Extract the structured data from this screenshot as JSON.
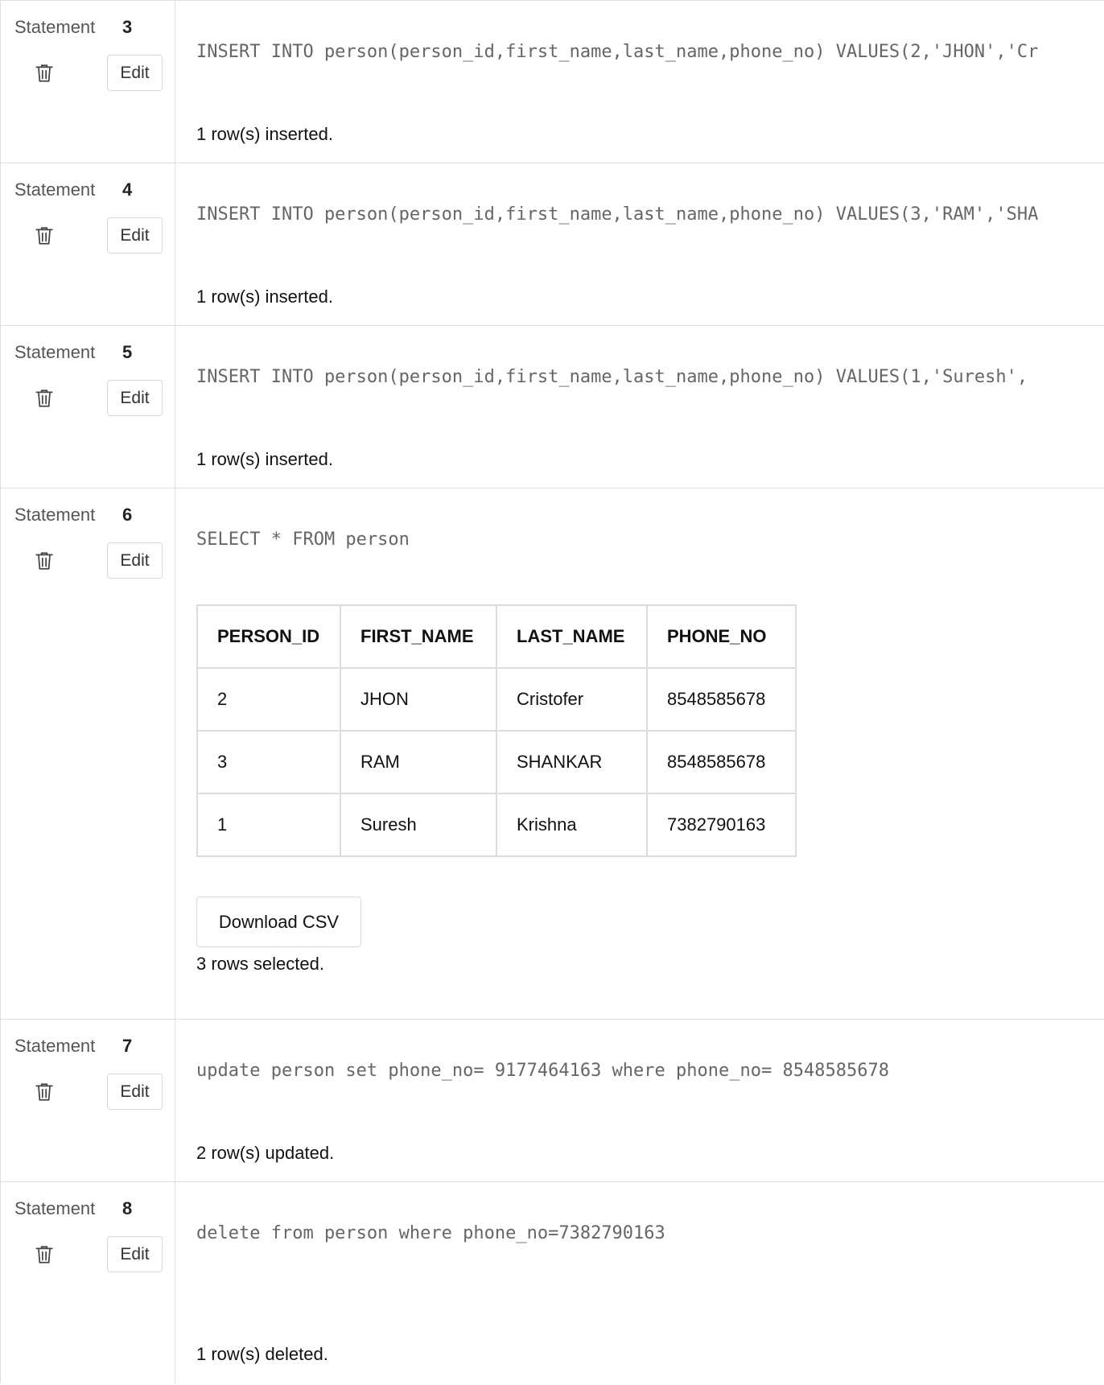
{
  "statements": [
    {
      "label": "Statement",
      "number": "3",
      "edit_label": "Edit",
      "sql": "INSERT INTO person(person_id,first_name,last_name,phone_no) VALUES(2,'JHON','Cr",
      "result": "1 row(s) inserted."
    },
    {
      "label": "Statement",
      "number": "4",
      "edit_label": "Edit",
      "sql": "INSERT INTO person(person_id,first_name,last_name,phone_no) VALUES(3,'RAM','SHA",
      "result": "1 row(s) inserted."
    },
    {
      "label": "Statement",
      "number": "5",
      "edit_label": "Edit",
      "sql": "INSERT INTO person(person_id,first_name,last_name,phone_no) VALUES(1,'Suresh',",
      "result": "1 row(s) inserted."
    },
    {
      "label": "Statement",
      "number": "6",
      "edit_label": "Edit",
      "sql": "SELECT * FROM person",
      "table": {
        "columns": [
          "PERSON_ID",
          "FIRST_NAME",
          "LAST_NAME",
          "PHONE_NO"
        ],
        "rows": [
          [
            "2",
            "JHON",
            "Cristofer",
            "8548585678"
          ],
          [
            "3",
            "RAM",
            "SHANKAR",
            "8548585678"
          ],
          [
            "1",
            "Suresh",
            "Krishna",
            "7382790163"
          ]
        ]
      },
      "download_label": "Download CSV",
      "result": "3 rows selected."
    },
    {
      "label": "Statement",
      "number": "7",
      "edit_label": "Edit",
      "sql": "update person set phone_no= 9177464163 where phone_no= 8548585678",
      "result": "2 row(s) updated."
    },
    {
      "label": "Statement",
      "number": "8",
      "edit_label": "Edit",
      "sql": "delete from person where phone_no=7382790163",
      "result": "1 row(s) deleted."
    }
  ],
  "icons": {
    "delete": "trash-icon"
  }
}
